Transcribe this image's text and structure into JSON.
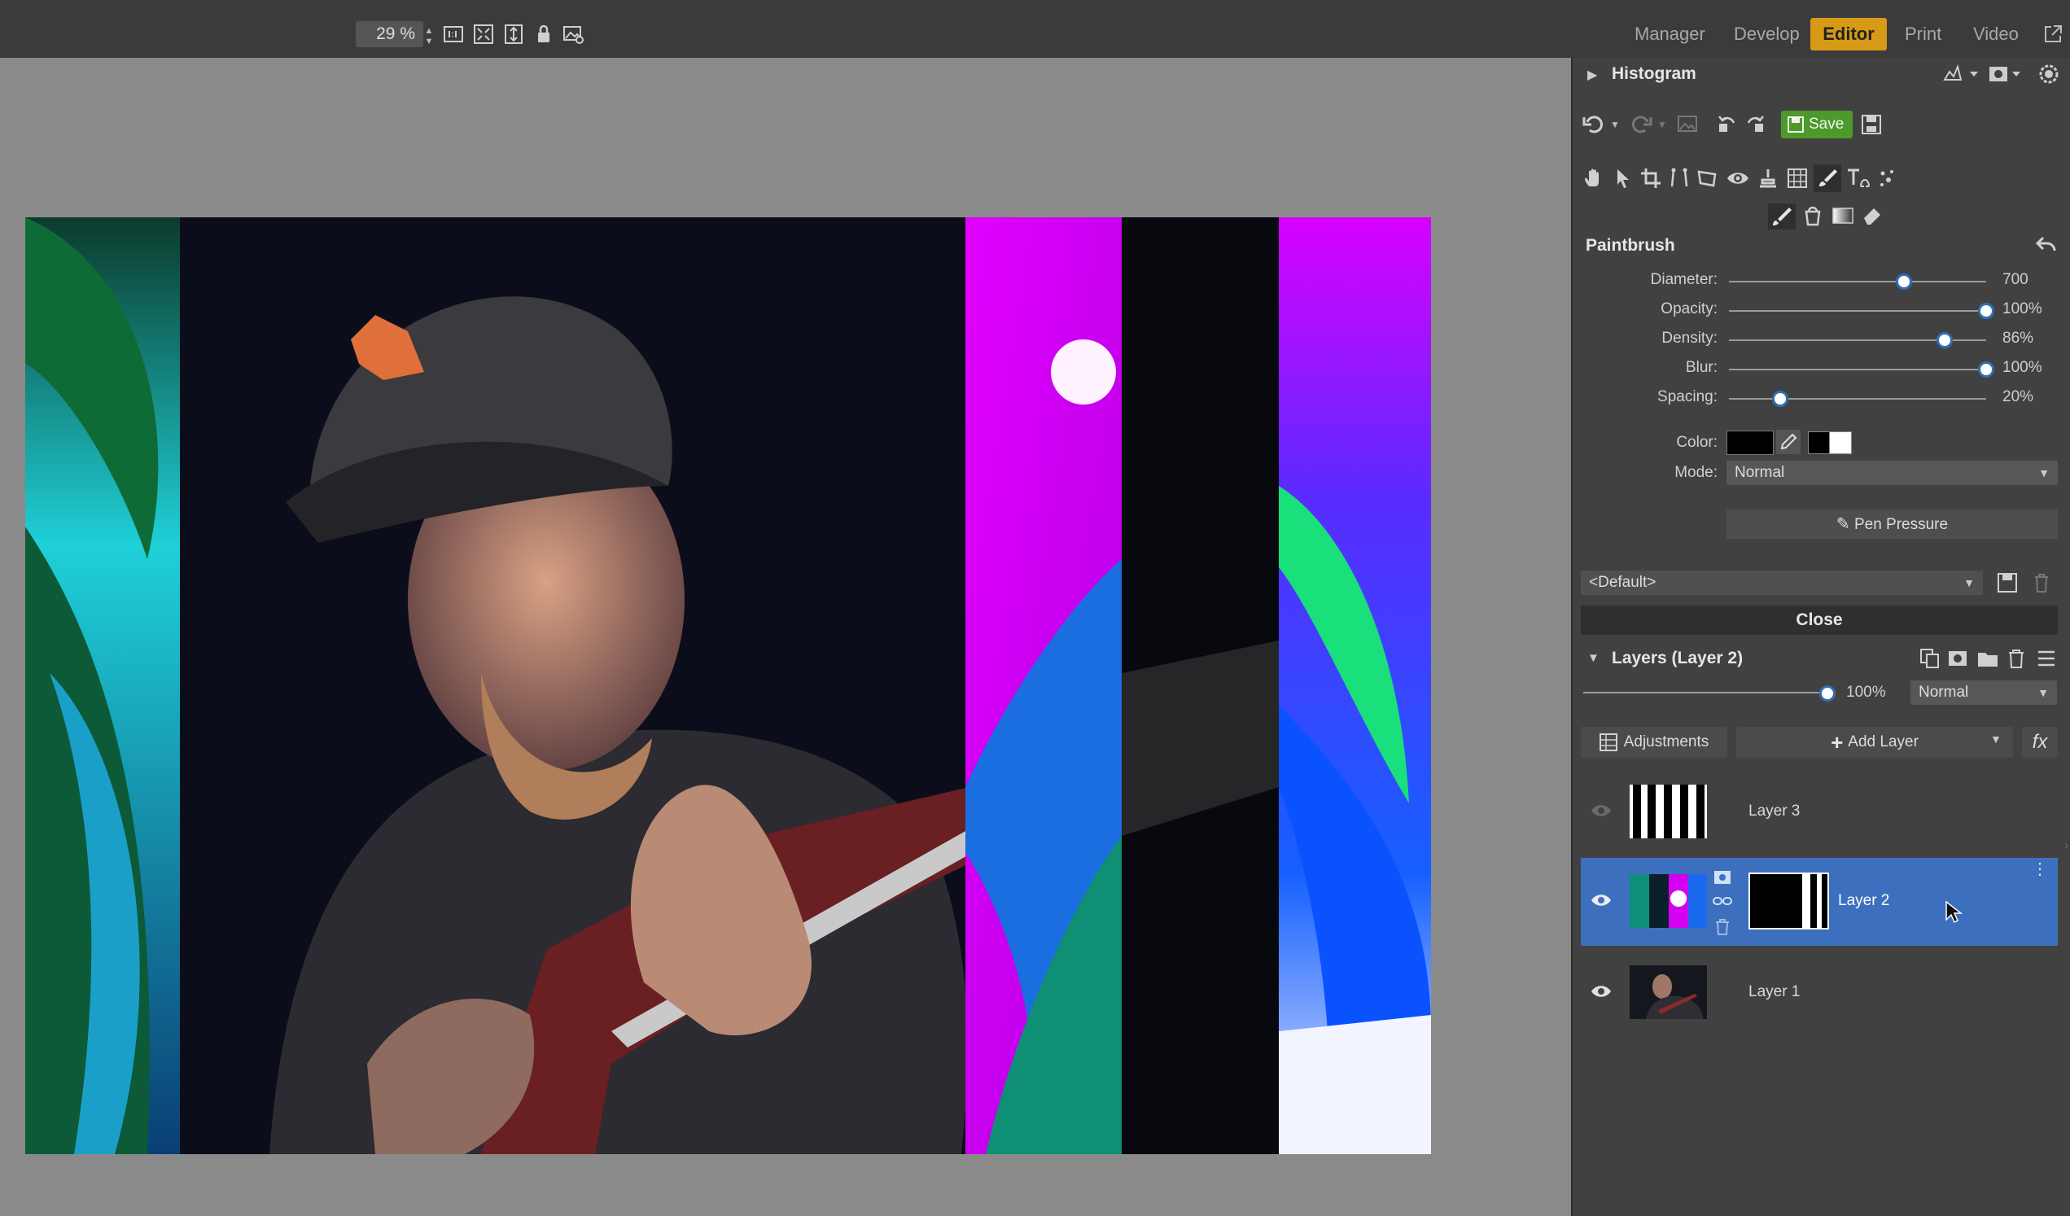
{
  "toolbar": {
    "zoom_value": "29 %",
    "spin_up": "▲",
    "spin_down": "▼"
  },
  "nav": {
    "tabs": [
      "Manager",
      "Develop",
      "Editor",
      "Print",
      "Video"
    ],
    "active": "Editor"
  },
  "histogram": {
    "title": "Histogram"
  },
  "actions": {
    "save_label": "Save"
  },
  "paintbrush": {
    "title": "Paintbrush",
    "sliders": [
      {
        "label": "Diameter:",
        "value": "700",
        "level": 0.68
      },
      {
        "label": "Opacity:",
        "value": "100%",
        "level": 1.0
      },
      {
        "label": "Density:",
        "value": "86%",
        "level": 0.84
      },
      {
        "label": "Blur:",
        "value": "100%",
        "level": 1.0
      },
      {
        "label": "Spacing:",
        "value": "20%",
        "level": 0.2
      }
    ],
    "color_label": "Color:",
    "mode_label": "Mode:",
    "mode_value": "Normal",
    "pen_pressure": "Pen Pressure",
    "preset_value": "<Default>",
    "close_label": "Close"
  },
  "layers": {
    "title": "Layers (Layer 2)",
    "opacity_value": "100%",
    "opacity_level": 1.0,
    "blend_mode": "Normal",
    "adjustments_label": "Adjustments",
    "add_layer_label": "Add Layer",
    "fx_label": "fx",
    "items": [
      {
        "name": "Layer 3",
        "visible": false,
        "selected": false
      },
      {
        "name": "Layer 2",
        "visible": true,
        "selected": true
      },
      {
        "name": "Layer 1",
        "visible": true,
        "selected": false
      }
    ]
  },
  "colors": {
    "accent": "#d79a16",
    "selection": "#3c6fbe",
    "save_green": "#4c9a2a",
    "magenta": "#e100ff"
  }
}
